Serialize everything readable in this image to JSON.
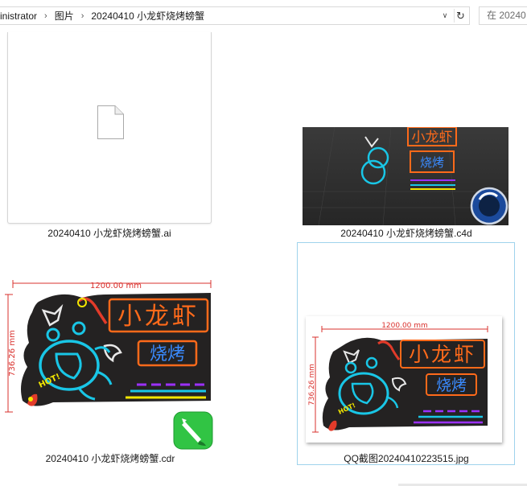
{
  "address_bar": {
    "crumbs": [
      "inistrator",
      "图片",
      "20240410 小龙虾烧烤螃蟹"
    ],
    "search_placeholder": "在 20240"
  },
  "files": [
    {
      "name": "20240410 小龙虾烧烤螃蟹.ai",
      "kind": "ai",
      "icon": "generic-document-icon"
    },
    {
      "name": "20240410 小龙虾烧烤螃蟹.c4d",
      "kind": "c4d",
      "icon": "cinema4d-icon"
    },
    {
      "name": "20240410 小龙虾烧烤螃蟹.cdr",
      "kind": "cdr",
      "icon": "coreldraw-icon"
    },
    {
      "name": "QQ截图20240410223515.jpg",
      "kind": "jpg",
      "selected": true
    }
  ],
  "artwork": {
    "width_label": "1200.00 mm",
    "height_label": "736.26 mm",
    "title_chars": "小龙虾",
    "subtitle_chars": "烧烤",
    "badge": "HOT!"
  },
  "colors": {
    "selection_border": "#9fd3ec",
    "neon_orange": "#ff6a1a",
    "neon_cyan": "#19c6e6",
    "neon_blue": "#3a8bff",
    "neon_yellow": "#f2e600",
    "neon_purple": "#9b30ff",
    "dimension_red": "#d9302c",
    "board_bg": "#242222"
  }
}
